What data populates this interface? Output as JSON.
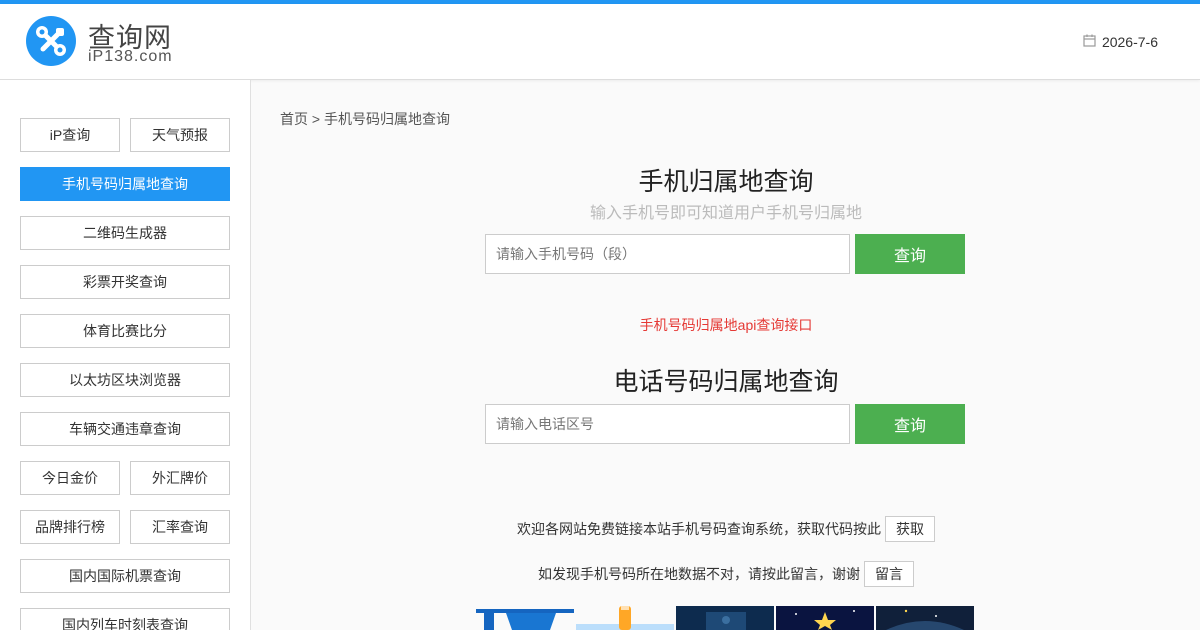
{
  "header": {
    "site_title": "查询网",
    "site_domain": "iP138.com",
    "date": "2026-7-6"
  },
  "sidebar": {
    "items": [
      {
        "label": "iP查询"
      },
      {
        "label": "天气预报"
      },
      {
        "label": "手机号码归属地查询",
        "active": true
      },
      {
        "label": "二维码生成器"
      },
      {
        "label": "彩票开奖查询"
      },
      {
        "label": "体育比赛比分"
      },
      {
        "label": "以太坊区块浏览器"
      },
      {
        "label": "车辆交通违章查询"
      },
      {
        "label": "今日金价"
      },
      {
        "label": "外汇牌价"
      },
      {
        "label": "品牌排行榜"
      },
      {
        "label": "汇率查询"
      },
      {
        "label": "国内国际机票查询"
      },
      {
        "label": "国内列车时刻表查询"
      }
    ]
  },
  "main": {
    "breadcrumb": "首页 > 手机号码归属地查询",
    "mobile": {
      "title": "手机归属地查询",
      "subtitle": "输入手机号即可知道用户手机号归属地",
      "placeholder": "请输入手机号码（段）",
      "button": "查询"
    },
    "api_link": "手机号码归属地api查询接口",
    "phone": {
      "title": "电话号码归属地查询",
      "placeholder": "请输入电话区号",
      "button": "查询"
    },
    "promo": {
      "text": "欢迎各网站免费链接本站手机号码查询系统，获取代码按此",
      "button": "获取"
    },
    "feedback": {
      "text": "如发现手机号码所在地数据不对，请按此留言，谢谢",
      "button": "留言"
    }
  },
  "colors": {
    "accent": "#2196f3",
    "query_button": "#4caf50",
    "api_link": "#e53935"
  }
}
